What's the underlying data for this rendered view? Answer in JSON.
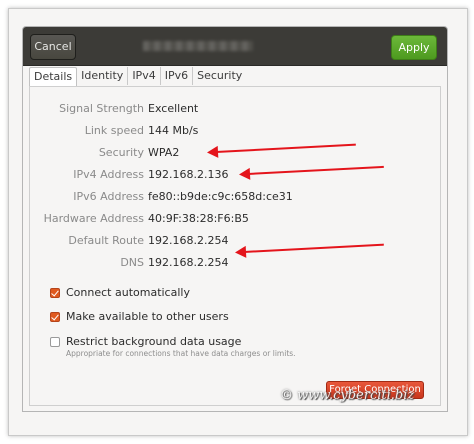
{
  "header": {
    "cancel_label": "Cancel",
    "apply_label": "Apply"
  },
  "tabs": [
    {
      "label": "Details",
      "active": true
    },
    {
      "label": "Identity",
      "active": false
    },
    {
      "label": "IPv4",
      "active": false
    },
    {
      "label": "IPv6",
      "active": false
    },
    {
      "label": "Security",
      "active": false
    }
  ],
  "details": [
    {
      "label": "Signal Strength",
      "value": "Excellent"
    },
    {
      "label": "Link speed",
      "value": "144 Mb/s"
    },
    {
      "label": "Security",
      "value": "WPA2"
    },
    {
      "label": "IPv4 Address",
      "value": "192.168.2.136"
    },
    {
      "label": "IPv6 Address",
      "value": "fe80::b9de:c9c:658d:ce31"
    },
    {
      "label": "Hardware Address",
      "value": "40:9F:38:28:F6:B5"
    },
    {
      "label": "Default Route",
      "value": "192.168.2.254"
    },
    {
      "label": "DNS",
      "value": "192.168.2.254"
    }
  ],
  "options": [
    {
      "label": "Connect automatically",
      "checked": true
    },
    {
      "label": "Make available to other users",
      "checked": true
    },
    {
      "label": "Restrict background data usage",
      "checked": false,
      "description": "Appropriate for connections that have data charges or limits."
    }
  ],
  "forget_label": "Forget Connection",
  "watermark": "© www.cyberciti.biz",
  "colors": {
    "titlebar": "#3c3b37",
    "apply": "#5aa82a",
    "checkbox": "#e05a1f",
    "forget": "#d9441f",
    "annotation_arrow": "#e4141b"
  }
}
